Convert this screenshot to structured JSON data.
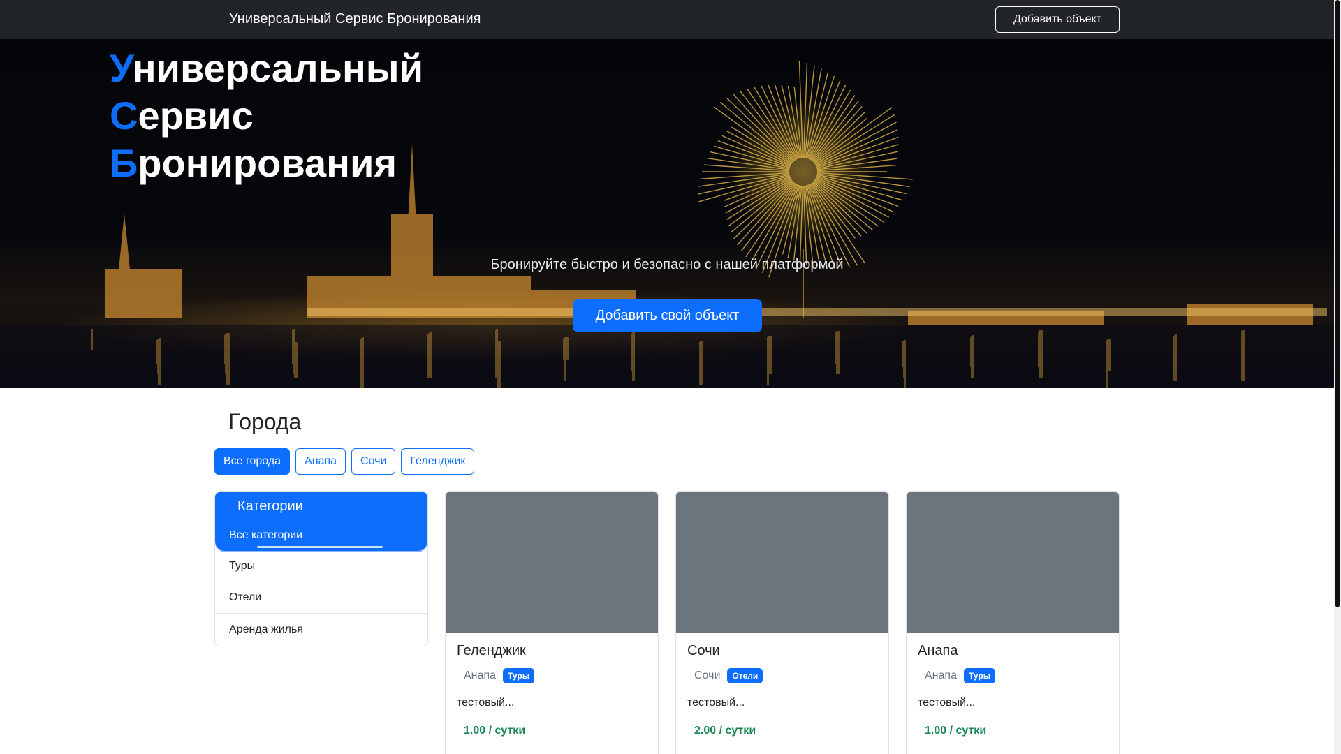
{
  "navbar": {
    "brand": "Универсальный Сервис Бронирования",
    "add_button": "Добавить объект"
  },
  "hero": {
    "title_lines": [
      {
        "first": "У",
        "rest": "ниверсальный"
      },
      {
        "first": "С",
        "rest": "ервис"
      },
      {
        "first": "Б",
        "rest": "ронирования"
      }
    ],
    "subtitle": "Бронируйте быстро и безопасно с нашей платформой",
    "cta": "Добавить свой объект"
  },
  "cities": {
    "title": "Города",
    "filters": [
      "Все города",
      "Анапа",
      "Сочи",
      "Геленджик"
    ],
    "active": "Все города"
  },
  "categories": {
    "header": "Категории",
    "items": [
      "Все категории",
      "Туры",
      "Отели",
      "Аренда жилья"
    ],
    "active": "Все категории"
  },
  "listings": [
    {
      "title": "Геленджик",
      "city": "Анапа",
      "badge": "Туры",
      "description": "тестовый...",
      "price": "1.00 / сутки"
    },
    {
      "title": "Сочи",
      "city": "Сочи",
      "badge": "Отели",
      "description": "тестовый...",
      "price": "2.00 / сутки"
    },
    {
      "title": "Анапа",
      "city": "Анапа",
      "badge": "Туры",
      "description": "тестовый...",
      "price": "1.00 / сутки"
    }
  ],
  "colors": {
    "primary": "#0d6efd",
    "navbar": "#212529",
    "price": "#198754",
    "placeholder_image": "#6c757d"
  }
}
